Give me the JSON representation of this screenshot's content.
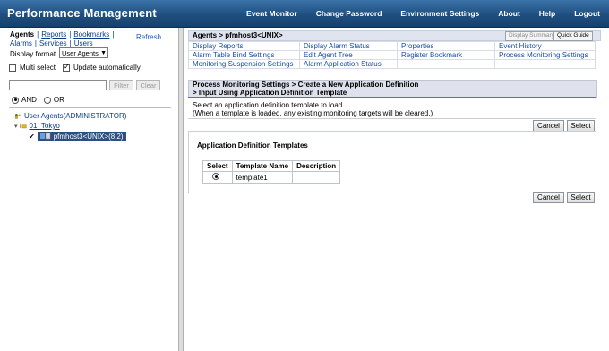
{
  "app": {
    "title": "Performance Management"
  },
  "topmenu": [
    "Event Monitor",
    "Change Password",
    "Environment Settings",
    "About",
    "Help",
    "Logout"
  ],
  "left": {
    "nav_row1": [
      "Agents",
      "Reports",
      "Bookmarks"
    ],
    "nav_row2": [
      "Alarms",
      "Services",
      "Users"
    ],
    "refresh": "Refresh",
    "display_format_label": "Display format",
    "display_format_value": "User Agents",
    "multi_select": "Multi select",
    "update_auto": "Update automatically",
    "filter_button": "Filter",
    "clear_button": "Clear",
    "and_label": "AND",
    "or_label": "OR",
    "tree": {
      "root": "User Agents(ADMINISTRATOR)",
      "child": "01_Tokyo",
      "leaf": "pfmhost3<UNIX>(8.2)"
    }
  },
  "right": {
    "breadcrumb": "Agents > pfmhost3<UNIX>",
    "display_summary": "Display Summary",
    "quick_guide": "Quick Guide",
    "menu": [
      [
        "Display Reports",
        "Display Alarm Status",
        "Properties",
        "Event History"
      ],
      [
        "Alarm Table Bind Settings",
        "Edit Agent Tree",
        "Register Bookmark",
        "Process Monitoring Settings"
      ],
      [
        "Monitoring Suspension Settings",
        "Alarm Application Status",
        "",
        ""
      ]
    ],
    "section_line1": "Process Monitoring Settings >  Create a New Application Definition",
    "section_line2": "> Input Using Application Definition Template",
    "desc_line1": "Select an application definition template to load.",
    "desc_line2": "(When a template is loaded, any existing monitoring targets will be cleared.)",
    "cancel": "Cancel",
    "select": "Select",
    "panel_title": "Application Definition Templates",
    "table_headers": [
      "Select",
      "Template Name",
      "Description"
    ],
    "table_rows": [
      {
        "name": "template1",
        "description": ""
      }
    ]
  }
}
